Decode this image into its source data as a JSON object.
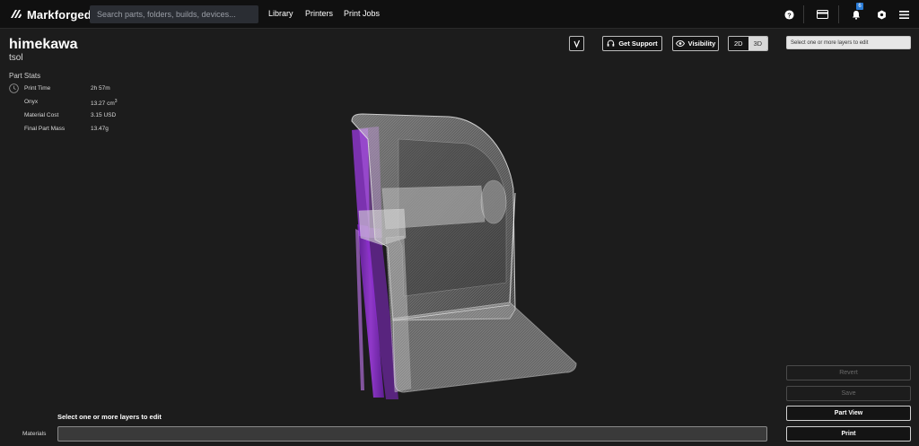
{
  "nav": {
    "brand": "Markforged",
    "search_placeholder": "Search parts, folders, builds, devices...",
    "links": [
      "Library",
      "Printers",
      "Print Jobs"
    ],
    "notification_count": "6"
  },
  "part": {
    "name": "himekawa",
    "subtitle": "tsol"
  },
  "stats": {
    "title": "Part Stats",
    "rows": [
      {
        "label": "Print Time",
        "value": "2h 57m"
      },
      {
        "label": "Onyx",
        "value": "13.27 cm",
        "sup": "3"
      },
      {
        "label": "Material Cost",
        "value": "3.15 USD"
      },
      {
        "label": "Final Part Mass",
        "value": "13.47g"
      }
    ]
  },
  "toolbar": {
    "support_label": "Get Support",
    "visibility_label": "Visibility",
    "view_2d": "2D",
    "view_3d": "3D",
    "layer_placeholder": "Select one or more layers to edit"
  },
  "actions": {
    "revert": "Revert",
    "save": "Save",
    "part_view": "Part View",
    "print": "Print"
  },
  "bottom": {
    "layer_hint": "Select one or more layers to edit",
    "materials_label": "Materials"
  },
  "colors": {
    "background": "#1c1c1c",
    "nav": "#101010",
    "part_fill": "#8a8a8a",
    "fiber_highlight": "#9b30d9"
  }
}
